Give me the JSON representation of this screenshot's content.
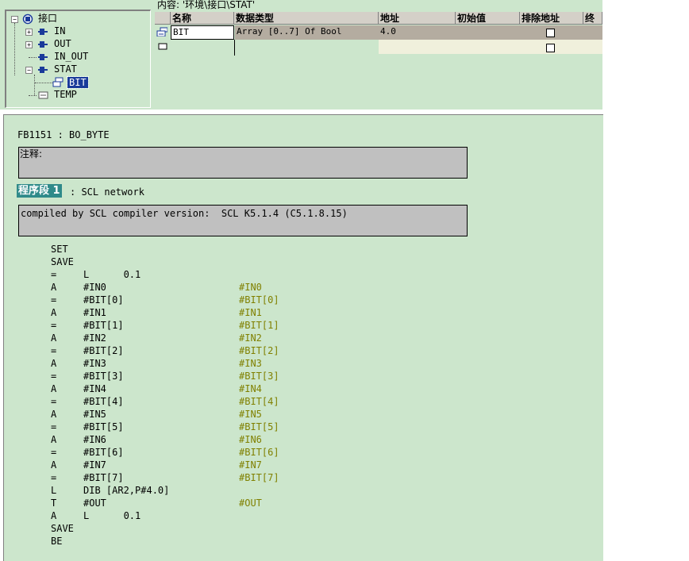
{
  "path": {
    "label": "内容:  '环境\\接口\\STAT'"
  },
  "tree": {
    "root": "接口",
    "items": [
      {
        "label": "IN",
        "expander": "+"
      },
      {
        "label": "OUT",
        "expander": "+"
      },
      {
        "label": "IN_OUT",
        "expander": ""
      },
      {
        "label": "STAT",
        "expander": "−"
      },
      {
        "label": "BIT",
        "expander": ""
      },
      {
        "label": "TEMP",
        "expander": ""
      }
    ]
  },
  "grid": {
    "headers": [
      "名称",
      "数据类型",
      "地址",
      "初始值",
      "排除地址",
      "终准"
    ],
    "row1": {
      "name": "BIT",
      "type": "Array [0..7] Of Bool",
      "address": "4.0"
    }
  },
  "editor": {
    "block_title": "FB1151 : BO_BYTE",
    "comment_label": "注释:",
    "network_label": "程序段 1",
    "network_title": ": SCL network",
    "network_comment": "compiled by SCL compiler version:  SCL K5.1.4 (C5.1.8.15)",
    "code": [
      {
        "op": "SET",
        "operand": "",
        "comment": ""
      },
      {
        "op": "SAVE",
        "operand": "",
        "comment": ""
      },
      {
        "op": "=",
        "operand": "L      0.1",
        "comment": ""
      },
      {
        "op": "A",
        "operand": "#IN0",
        "comment": "#IN0"
      },
      {
        "op": "=",
        "operand": "#BIT[0]",
        "comment": "#BIT[0]"
      },
      {
        "op": "A",
        "operand": "#IN1",
        "comment": "#IN1"
      },
      {
        "op": "=",
        "operand": "#BIT[1]",
        "comment": "#BIT[1]"
      },
      {
        "op": "A",
        "operand": "#IN2",
        "comment": "#IN2"
      },
      {
        "op": "=",
        "operand": "#BIT[2]",
        "comment": "#BIT[2]"
      },
      {
        "op": "A",
        "operand": "#IN3",
        "comment": "#IN3"
      },
      {
        "op": "=",
        "operand": "#BIT[3]",
        "comment": "#BIT[3]"
      },
      {
        "op": "A",
        "operand": "#IN4",
        "comment": "#IN4"
      },
      {
        "op": "=",
        "operand": "#BIT[4]",
        "comment": "#BIT[4]"
      },
      {
        "op": "A",
        "operand": "#IN5",
        "comment": "#IN5"
      },
      {
        "op": "=",
        "operand": "#BIT[5]",
        "comment": "#BIT[5]"
      },
      {
        "op": "A",
        "operand": "#IN6",
        "comment": "#IN6"
      },
      {
        "op": "=",
        "operand": "#BIT[6]",
        "comment": "#BIT[6]"
      },
      {
        "op": "A",
        "operand": "#IN7",
        "comment": "#IN7"
      },
      {
        "op": "=",
        "operand": "#BIT[7]",
        "comment": "#BIT[7]"
      },
      {
        "op": "L",
        "operand": "DIB [AR2,P#4.0]",
        "comment": ""
      },
      {
        "op": "T",
        "operand": "#OUT",
        "comment": "#OUT"
      },
      {
        "op": "A",
        "operand": "L      0.1",
        "comment": ""
      },
      {
        "op": "SAVE",
        "operand": "",
        "comment": ""
      },
      {
        "op": "BE",
        "operand": "",
        "comment": ""
      }
    ]
  }
}
